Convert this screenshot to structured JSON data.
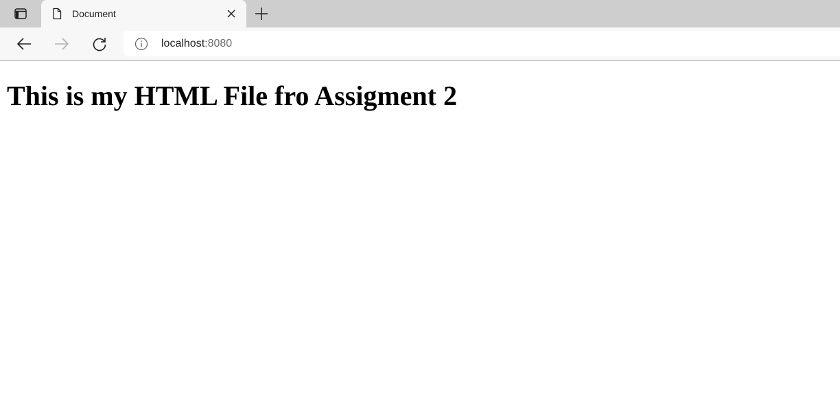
{
  "tabs": [
    {
      "title": "Document",
      "active": true
    }
  ],
  "address_bar": {
    "host": "localhost",
    "port": ":8080"
  },
  "page": {
    "heading": "This is my HTML File fro Assigment 2"
  },
  "icons": {
    "tab_actions": "tab-actions-icon",
    "tab_favicon": "document-icon",
    "tab_close": "close-icon",
    "new_tab": "plus-icon",
    "back": "arrow-left-icon",
    "forward": "arrow-right-icon",
    "reload": "reload-icon",
    "site_info": "info-icon"
  },
  "colors": {
    "tabstrip_bg": "#cecece",
    "toolbar_bg": "#f7f7f7",
    "disabled_icon": "#b0b0b0"
  }
}
